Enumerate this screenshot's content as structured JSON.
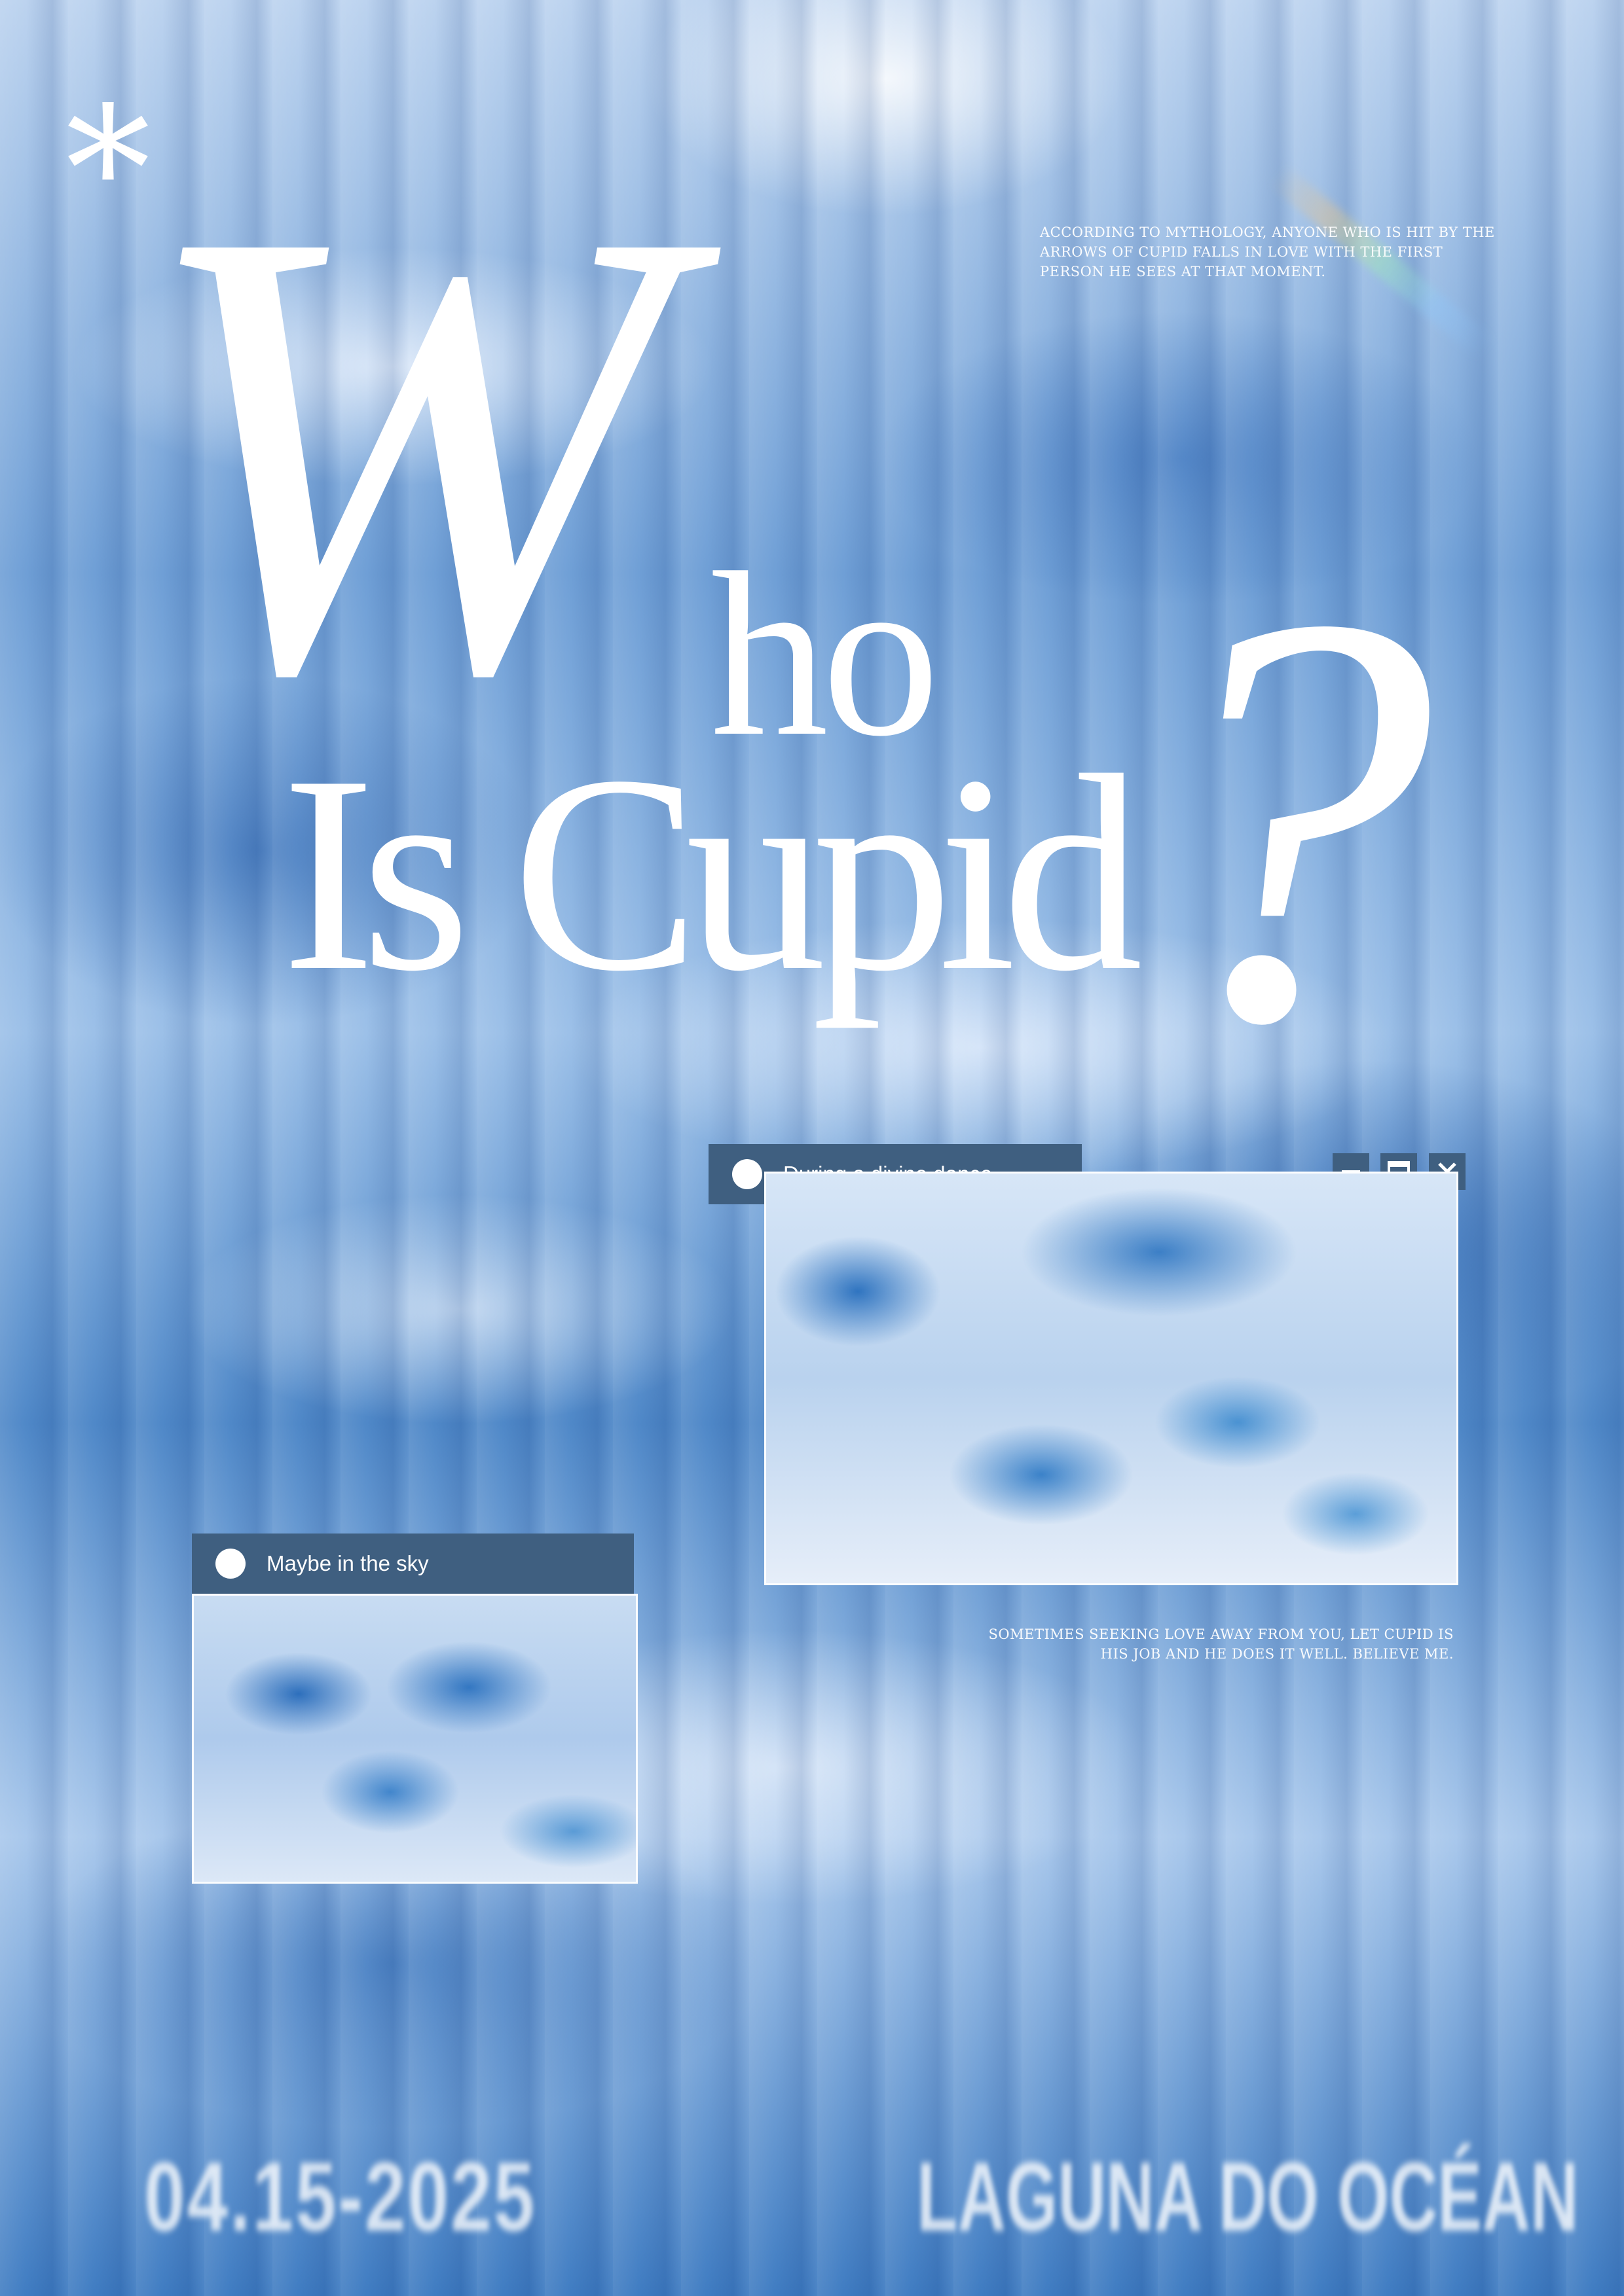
{
  "poster": {
    "asterisk": "*",
    "title_w": "W",
    "title_ho": "ho",
    "title_is_cupid": "Is Cupid",
    "title_question": "?",
    "blurb_top": "ACCORDING TO MYTHOLOGY, ANYONE WHO IS HIT BY THE ARROWS OF CUPID FALLS IN LOVE WITH THE FIRST PERSON HE SEES AT THAT MOMENT.",
    "blurb_mid": "SOMETIMES SEEKING LOVE AWAY FROM YOU, LET CUPID IS HIS JOB AND HE DOES IT WELL. BELIEVE ME.",
    "footer_date": "04.15-2025",
    "footer_place": "LAGUNA DO OCÉAN"
  },
  "window_main": {
    "title": "During a divine dance",
    "controls": {
      "minimize_icon": "minimize-icon",
      "maximize_icon": "maximize-icon",
      "close_icon": "close-icon"
    }
  },
  "window_small": {
    "title": "Maybe in the sky"
  },
  "colors": {
    "titlebar": "#3f5f80",
    "text": "#ffffff",
    "sky_blue": "#3f78b8"
  }
}
